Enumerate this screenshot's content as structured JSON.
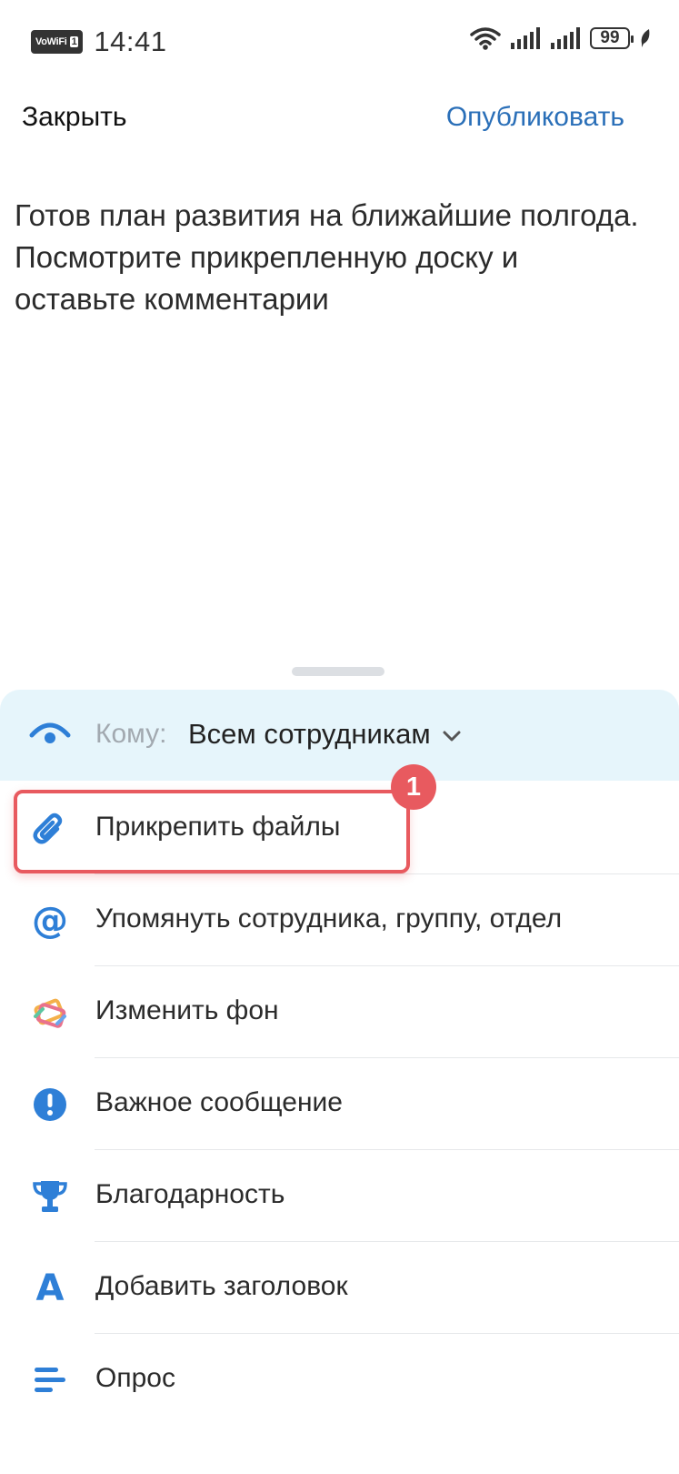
{
  "status_bar": {
    "vowifi": "VoWiFi",
    "sim": "1",
    "time": "14:41",
    "battery": "99"
  },
  "header": {
    "close_label": "Закрыть",
    "publish_label": "Опубликовать"
  },
  "post": {
    "text": "Готов план развития на ближайшие полгода. Посмотрите прикрепленную доску и оставьте комментарии"
  },
  "audience": {
    "label": "Кому:",
    "value": "Всем сотрудникам",
    "icon": "eye-icon"
  },
  "menu": {
    "items": [
      {
        "label": "Прикрепить файлы",
        "icon": "paperclip-icon"
      },
      {
        "label": "Упомянуть сотрудника, группу, отдел",
        "icon": "at-icon"
      },
      {
        "label": "Изменить фон",
        "icon": "background-icon"
      },
      {
        "label": "Важное сообщение",
        "icon": "exclamation-icon"
      },
      {
        "label": "Благодарность",
        "icon": "trophy-icon"
      },
      {
        "label": "Добавить заголовок",
        "icon": "letter-a-icon"
      },
      {
        "label": "Опрос",
        "icon": "poll-icon"
      }
    ]
  },
  "annotation": {
    "badge_number": "1"
  },
  "colors": {
    "accent": "#2e7fd7",
    "link": "#2a6fb8",
    "audience_bg": "#e6f5fb",
    "highlight": "#e85a5f"
  }
}
